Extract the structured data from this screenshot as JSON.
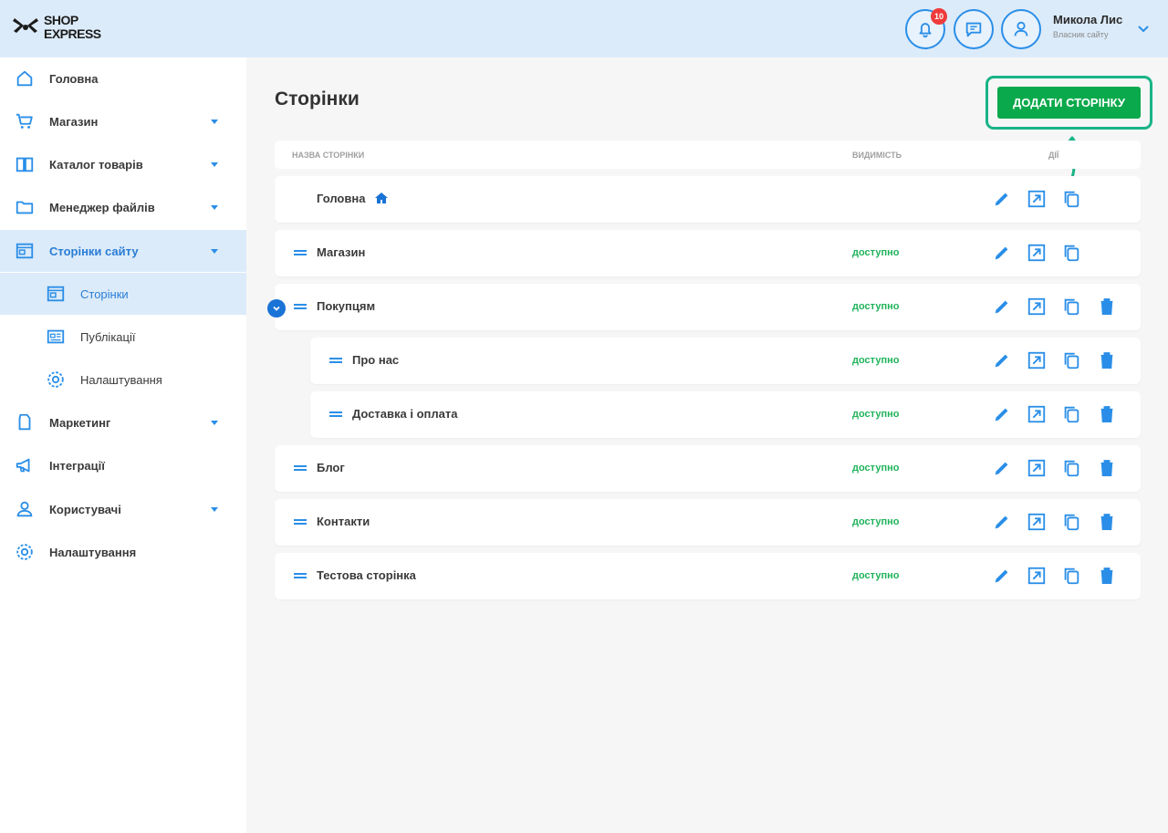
{
  "brand": {
    "logo_line1": "SHOP",
    "logo_line2": "EXPRESS"
  },
  "header": {
    "notifications_count": "10",
    "user_name": "Микола Лис",
    "user_role": "Власник сайту"
  },
  "sidebar": {
    "items": [
      {
        "label": "Головна"
      },
      {
        "label": "Магазин"
      },
      {
        "label": "Каталог товарів"
      },
      {
        "label": "Менеджер файлів"
      },
      {
        "label": "Сторінки сайту"
      },
      {
        "label": "Сторінки"
      },
      {
        "label": "Публікації"
      },
      {
        "label": "Налаштування"
      },
      {
        "label": "Маркетинг"
      },
      {
        "label": "Інтеграції"
      },
      {
        "label": "Користувачі"
      },
      {
        "label": "Налаштування"
      }
    ]
  },
  "main": {
    "title": "Сторінки",
    "add_button": "ДОДАТИ СТОРІНКУ",
    "columns": {
      "name": "Назва сторінки",
      "visibility": "Видимість",
      "actions": "Дії"
    },
    "rows": [
      {
        "name": "Головна",
        "visibility": ""
      },
      {
        "name": "Магазин",
        "visibility": "доступно"
      },
      {
        "name": "Покупцям",
        "visibility": "доступно"
      },
      {
        "name": "Про нас",
        "visibility": "доступно"
      },
      {
        "name": "Доставка і оплата",
        "visibility": "доступно"
      },
      {
        "name": "Блог",
        "visibility": "доступно"
      },
      {
        "name": "Контакти",
        "visibility": "доступно"
      },
      {
        "name": "Тестова сторінка",
        "visibility": "доступно"
      }
    ]
  },
  "colors": {
    "accent": "#2a8ee8",
    "primary_button": "#0aa94b",
    "highlight": "#1ab386",
    "available": "#1fb35a",
    "header_bg": "#dcebf9"
  }
}
